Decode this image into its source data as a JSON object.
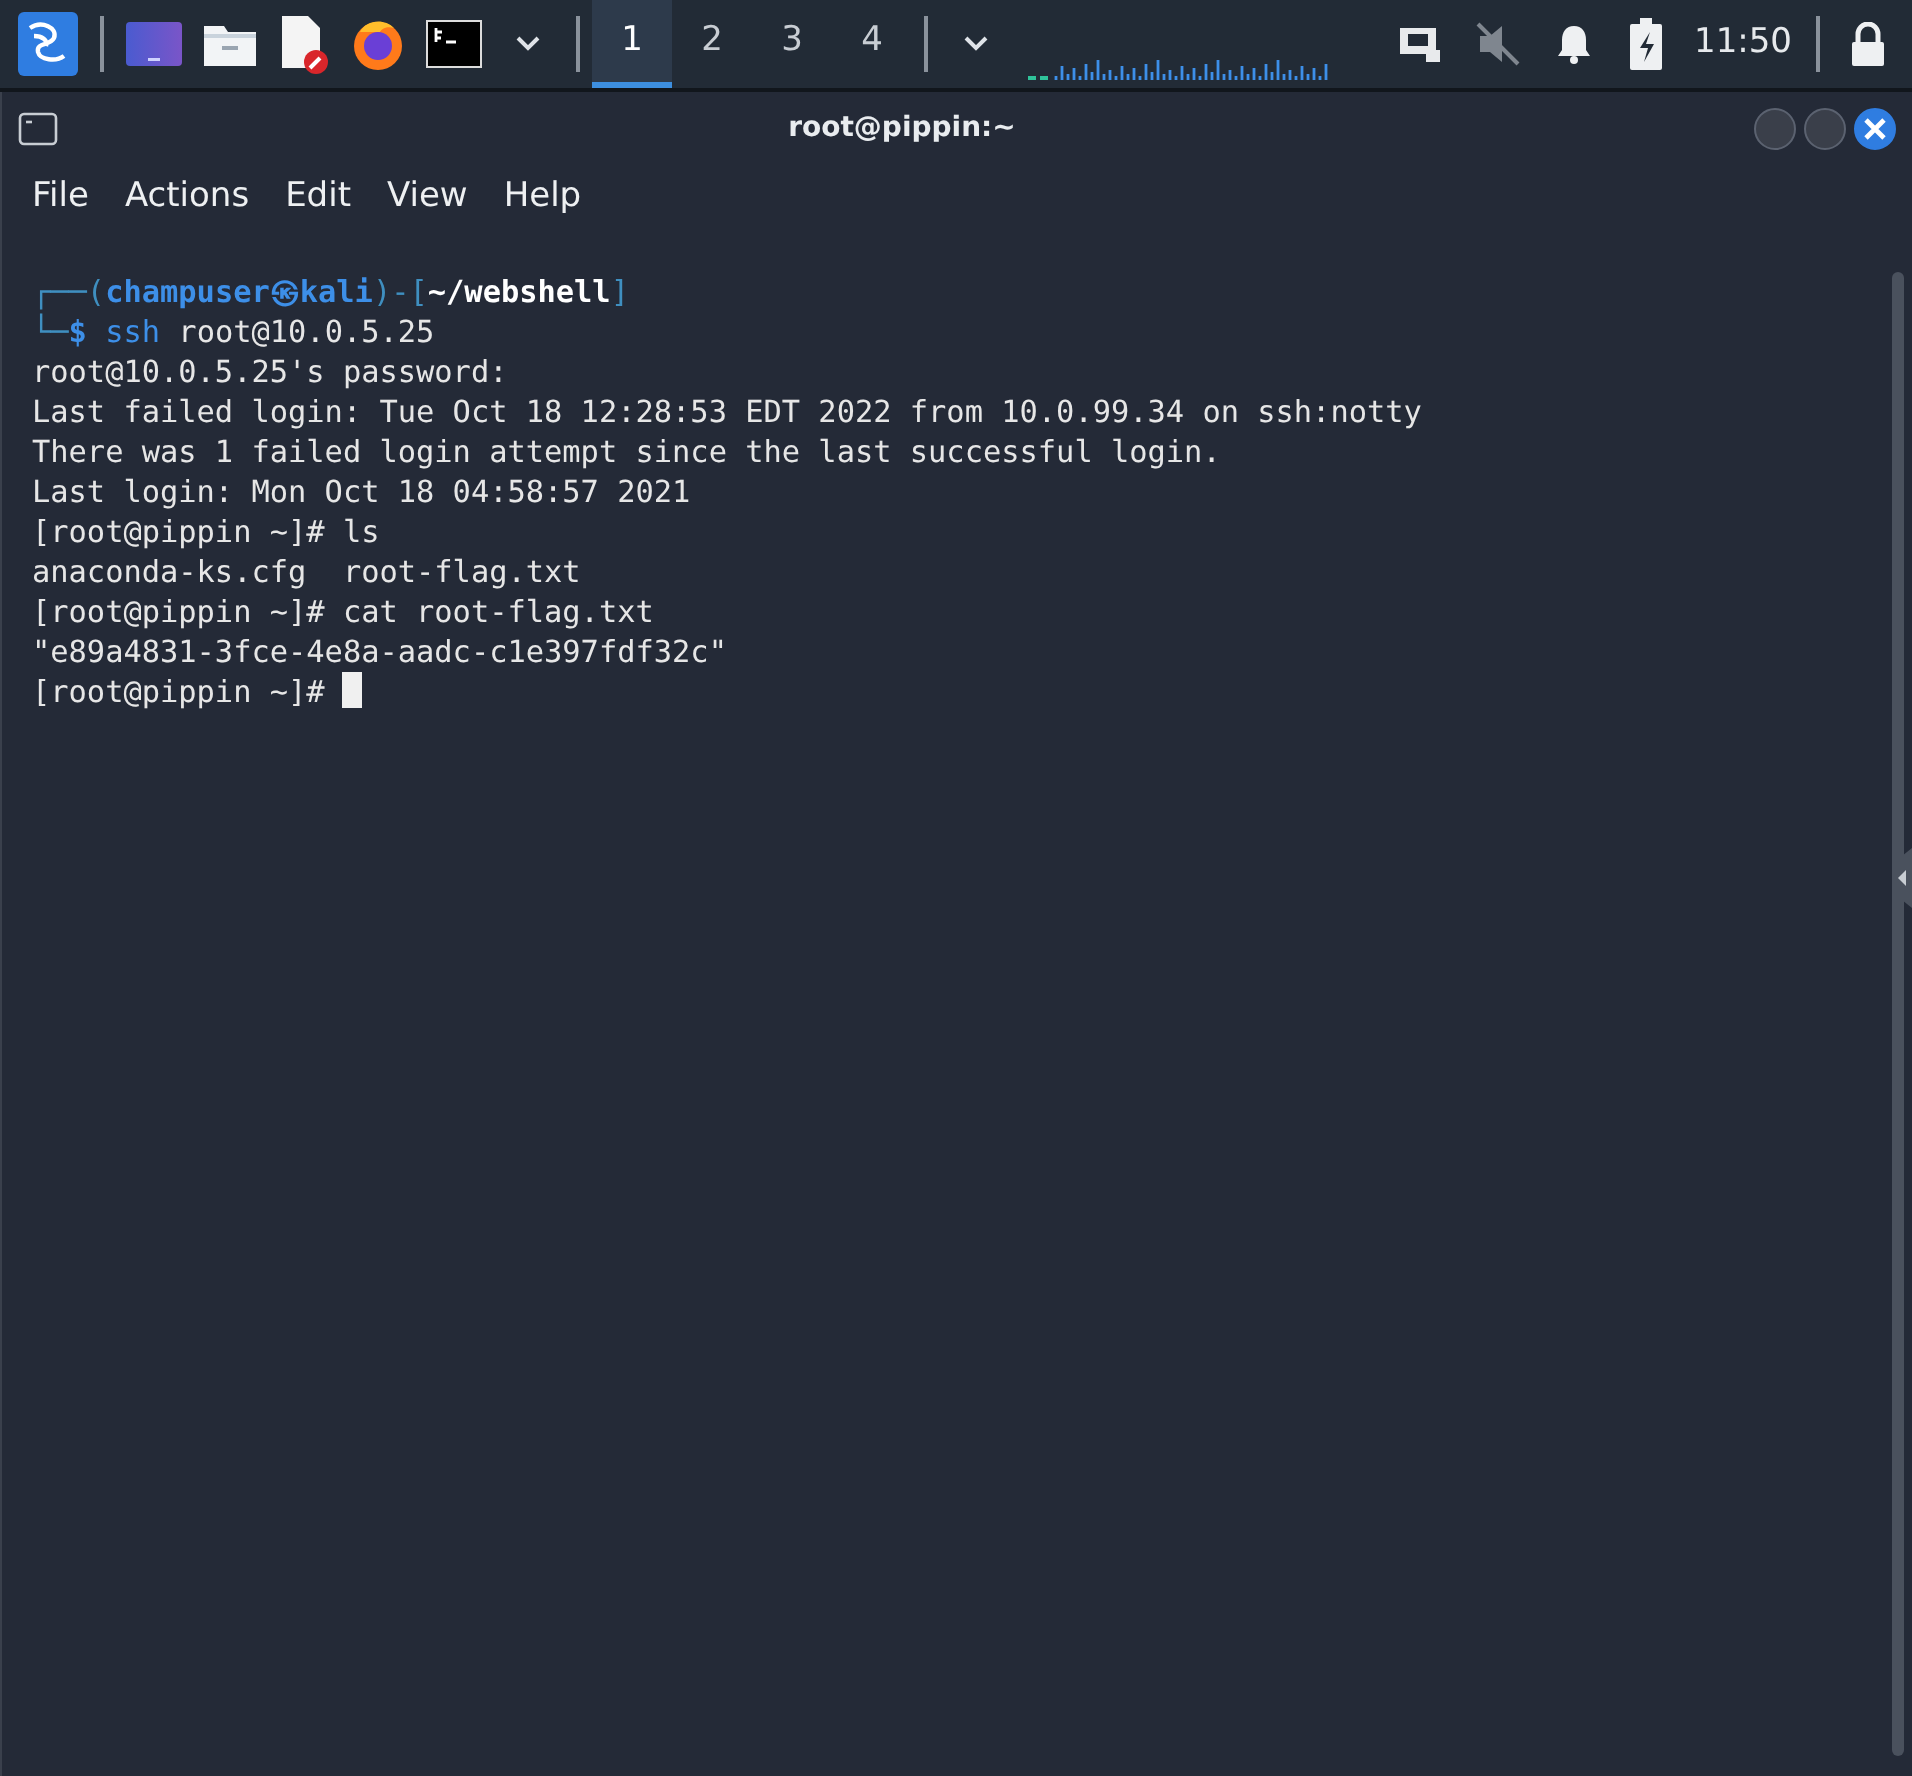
{
  "taskbar": {
    "launchers": [
      {
        "kind": "menu"
      },
      {
        "kind": "desktop"
      },
      {
        "kind": "files"
      },
      {
        "kind": "editor"
      },
      {
        "kind": "browser"
      },
      {
        "kind": "terminal"
      },
      {
        "kind": "caret"
      }
    ],
    "workspaces": [
      {
        "label": "1",
        "selected": true
      },
      {
        "label": "2",
        "selected": false
      },
      {
        "label": "3",
        "selected": false
      },
      {
        "label": "4",
        "selected": false
      }
    ],
    "tray": [
      {
        "kind": "network"
      },
      {
        "kind": "muted"
      },
      {
        "kind": "bell"
      },
      {
        "kind": "battery"
      }
    ],
    "clock": "11:50"
  },
  "window": {
    "title": "root@pippin:~",
    "menu": [
      "File",
      "Actions",
      "Edit",
      "View",
      "Help"
    ]
  },
  "terminal": {
    "lines": [
      [
        {
          "kind": "frame",
          "text": "┌──("
        },
        {
          "kind": "user",
          "text": "champuser㉿kali"
        },
        {
          "kind": "frame",
          "text": ")-["
        },
        {
          "kind": "path",
          "text": "~/webshell"
        },
        {
          "kind": "frame",
          "text": "]"
        }
      ],
      [
        {
          "kind": "frame",
          "text": "└─"
        },
        {
          "kind": "dollar",
          "text": "$ "
        },
        {
          "kind": "cmd",
          "text": "ssh"
        },
        {
          "kind": "plain",
          "text": " root@10.0.5.25"
        }
      ],
      [
        {
          "kind": "plain",
          "text": "root@10.0.5.25's password:"
        }
      ],
      [
        {
          "kind": "plain",
          "text": "Last failed login: Tue Oct 18 12:28:53 EDT 2022 from 10.0.99.34 on ssh:notty"
        }
      ],
      [
        {
          "kind": "plain",
          "text": "There was 1 failed login attempt since the last successful login."
        }
      ],
      [
        {
          "kind": "plain",
          "text": "Last login: Mon Oct 18 04:58:57 2021"
        }
      ],
      [
        {
          "kind": "plain",
          "text": "[root@pippin ~]# ls"
        }
      ],
      [
        {
          "kind": "plain",
          "text": "anaconda-ks.cfg  root-flag.txt"
        }
      ],
      [
        {
          "kind": "plain",
          "text": "[root@pippin ~]# cat root-flag.txt"
        }
      ],
      [
        {
          "kind": "plain",
          "text": "\"e89a4831-3fce-4e8a-aadc-c1e397fdf32c\""
        }
      ],
      [
        {
          "kind": "plain",
          "text": "[root@pippin ~]# "
        },
        {
          "kind": "cursor"
        }
      ]
    ]
  }
}
